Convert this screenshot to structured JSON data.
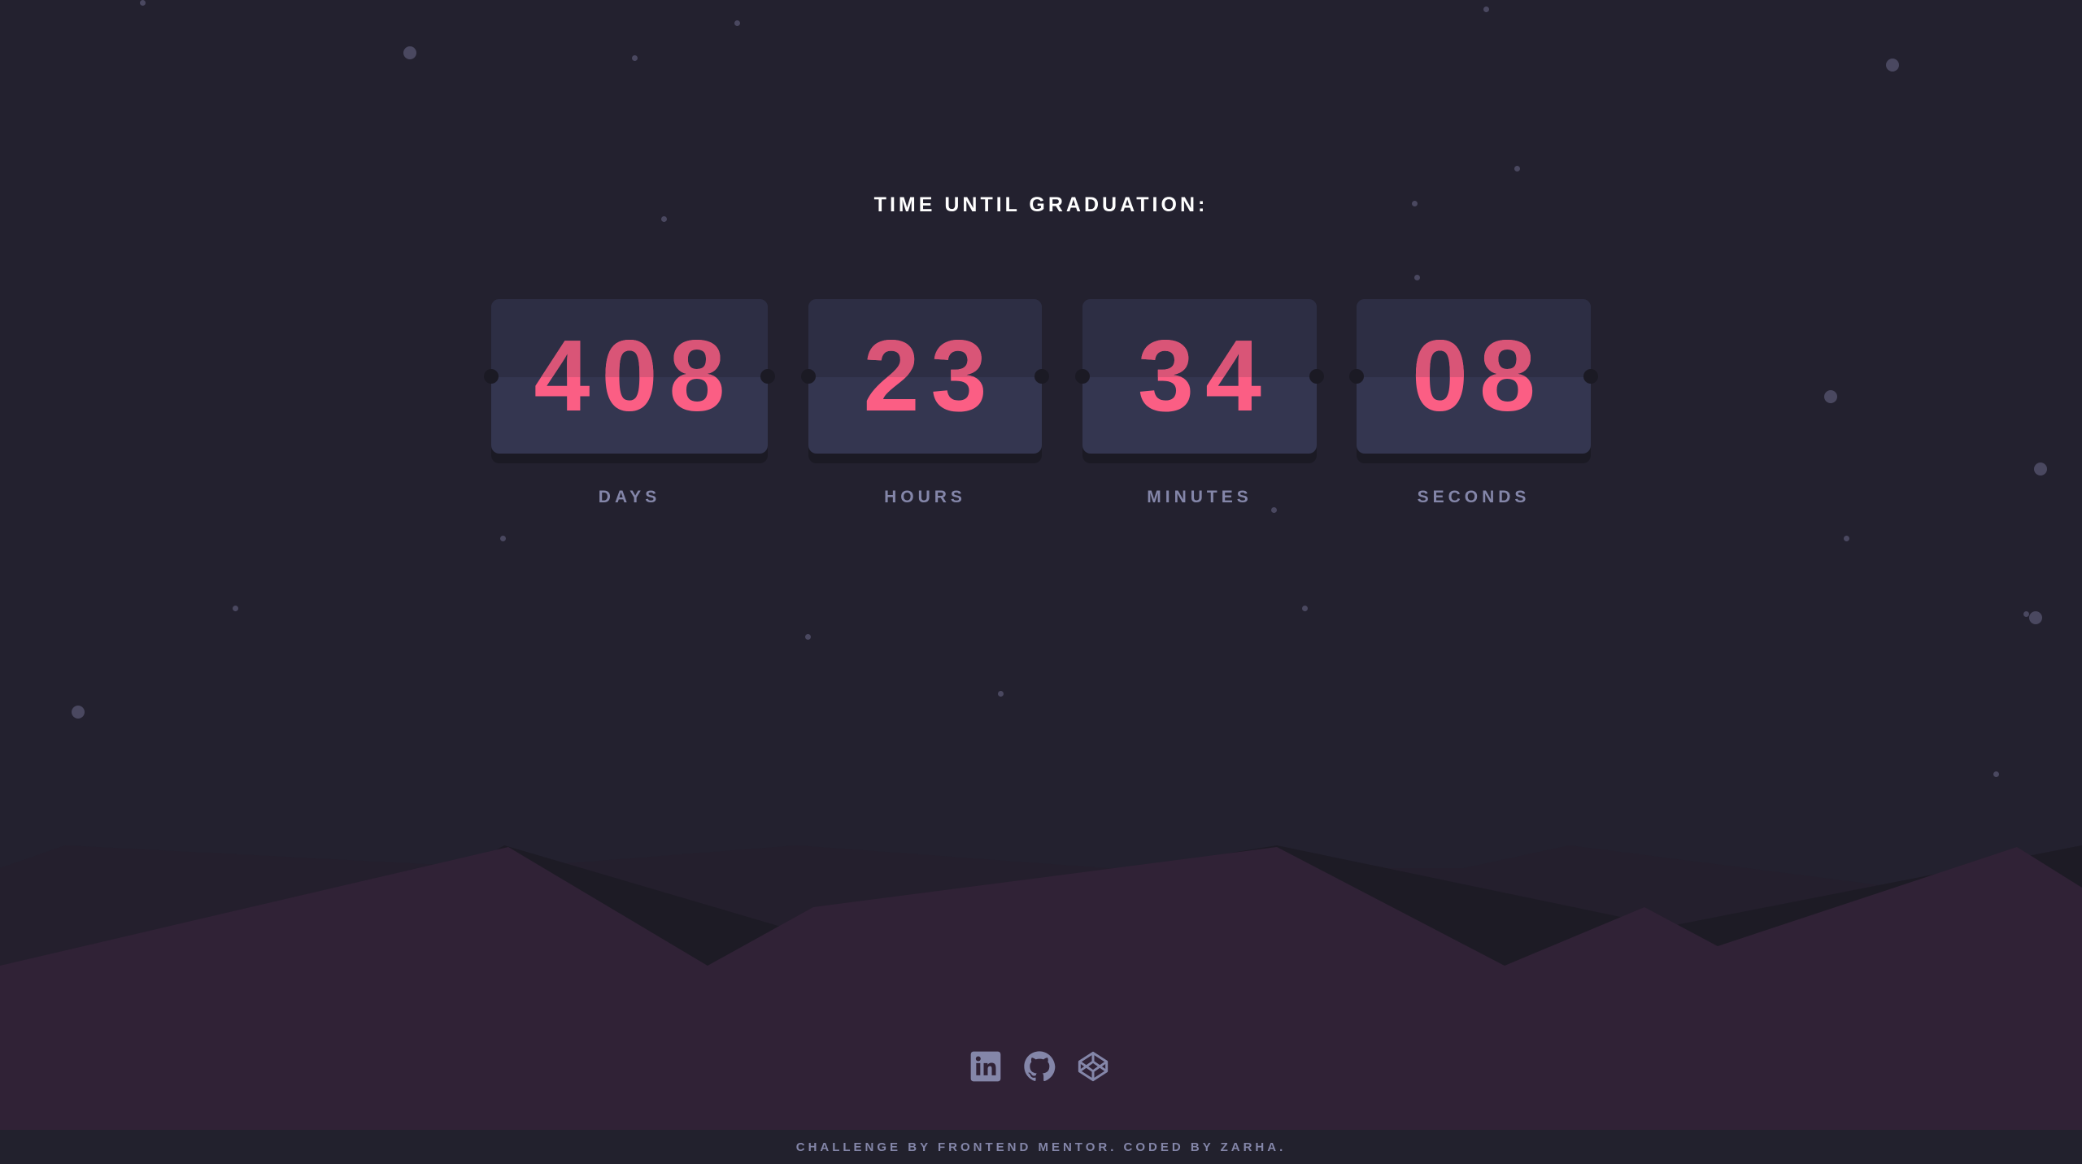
{
  "header": {
    "title": "TIME UNTIL GRADUATION:"
  },
  "countdown": [
    {
      "unit": "DAYS",
      "value": "408"
    },
    {
      "unit": "HOURS",
      "value": "23"
    },
    {
      "unit": "MINUTES",
      "value": "34"
    },
    {
      "unit": "SECONDS",
      "value": "08"
    }
  ],
  "socials": [
    {
      "name": "linkedin-icon"
    },
    {
      "name": "github-icon"
    },
    {
      "name": "codepen-icon"
    }
  ],
  "footer": {
    "text": "CHALLENGE BY FRONTEND MENTOR. CODED BY ZARHA."
  },
  "colors": {
    "background": "#23212f",
    "card": "#343650",
    "digits": "#fb5e84",
    "label": "#8486a9",
    "hills": "#302236"
  }
}
